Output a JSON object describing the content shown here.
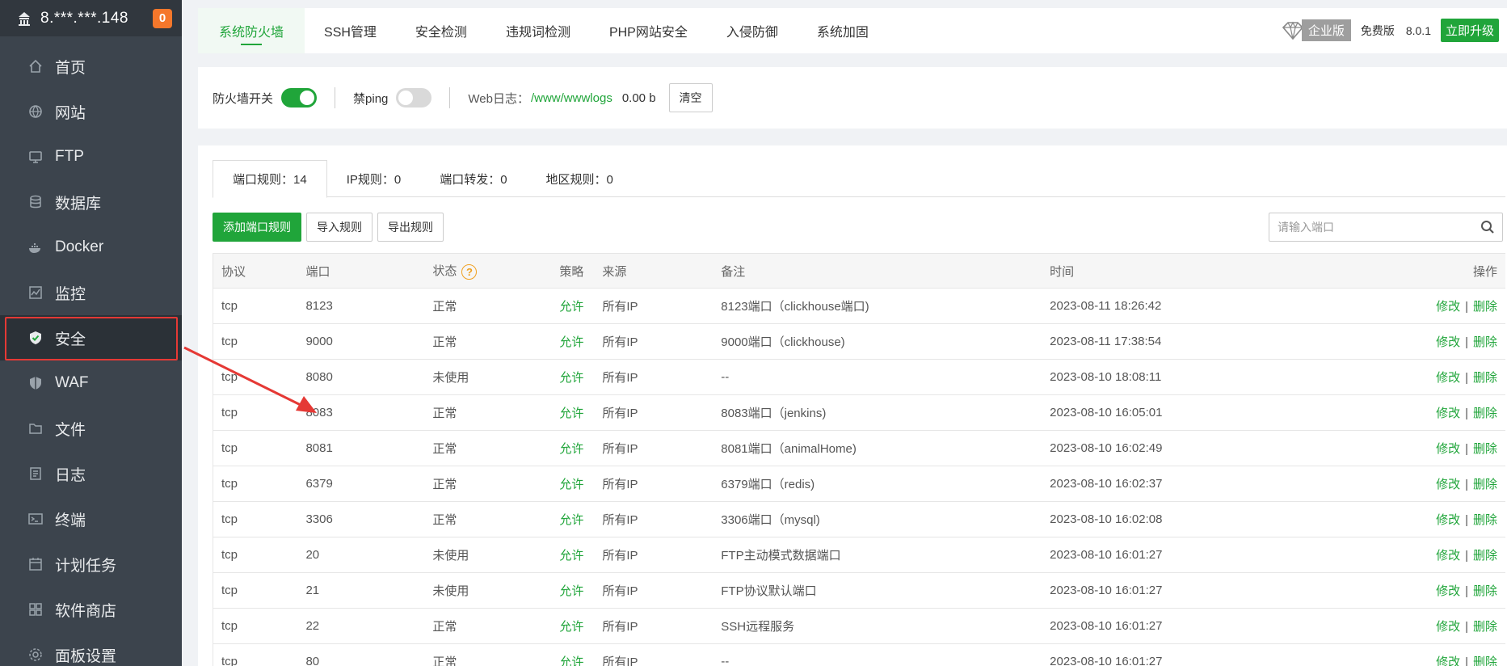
{
  "sidebar": {
    "host": "8.***.***.148",
    "badge": "0",
    "items": [
      {
        "label": "首页",
        "icon": "home-icon"
      },
      {
        "label": "网站",
        "icon": "globe-icon"
      },
      {
        "label": "FTP",
        "icon": "ftp-icon"
      },
      {
        "label": "数据库",
        "icon": "database-icon"
      },
      {
        "label": "Docker",
        "icon": "docker-icon"
      },
      {
        "label": "监控",
        "icon": "monitor-icon"
      },
      {
        "label": "安全",
        "icon": "shield-icon",
        "active": true
      },
      {
        "label": "WAF",
        "icon": "waf-shield-icon"
      },
      {
        "label": "文件",
        "icon": "folder-icon"
      },
      {
        "label": "日志",
        "icon": "log-icon"
      },
      {
        "label": "终端",
        "icon": "terminal-icon"
      },
      {
        "label": "计划任务",
        "icon": "calendar-icon"
      },
      {
        "label": "软件商店",
        "icon": "apps-icon"
      },
      {
        "label": "面板设置",
        "icon": "settings-icon"
      }
    ]
  },
  "topbar": {
    "tabs": [
      "系统防火墙",
      "SSH管理",
      "安全检测",
      "违规词检测",
      "PHP网站安全",
      "入侵防御",
      "系统加固"
    ],
    "enterprise_label": "企业版",
    "free_label": "免费版",
    "version": "8.0.1",
    "upgrade_label": "立即升级"
  },
  "switches": {
    "firewall_label": "防火墙开关",
    "ping_label": "禁ping",
    "weblog_label": "Web日志：",
    "weblog_path": "/www/wwwlogs",
    "weblog_size": "0.00 b",
    "clear_label": "清空"
  },
  "subtabs": [
    "端口规则：14",
    "IP规则：0",
    "端口转发：0",
    "地区规则：0"
  ],
  "toolbar": {
    "add_label": "添加端口规则",
    "import_label": "导入规则",
    "export_label": "导出规则",
    "search_placeholder": "请输入端口"
  },
  "table": {
    "headers": [
      "协议",
      "端口",
      "状态",
      "策略",
      "来源",
      "备注",
      "时间",
      "操作"
    ],
    "edit_label": "修改",
    "delete_label": "删除",
    "sep": "|",
    "rows": [
      {
        "proto": "tcp",
        "port": "8123",
        "status": "正常",
        "policy": "允许",
        "source": "所有IP",
        "note": "8123端口（clickhouse端口)",
        "time": "2023-08-11 18:26:42"
      },
      {
        "proto": "tcp",
        "port": "9000",
        "status": "正常",
        "policy": "允许",
        "source": "所有IP",
        "note": "9000端口（clickhouse)",
        "time": "2023-08-11 17:38:54"
      },
      {
        "proto": "tcp",
        "port": "8080",
        "status": "未使用",
        "policy": "允许",
        "source": "所有IP",
        "note": "--",
        "time": "2023-08-10 18:08:11"
      },
      {
        "proto": "tcp",
        "port": "8083",
        "status": "正常",
        "policy": "允许",
        "source": "所有IP",
        "note": "8083端口（jenkins)",
        "time": "2023-08-10 16:05:01"
      },
      {
        "proto": "tcp",
        "port": "8081",
        "status": "正常",
        "policy": "允许",
        "source": "所有IP",
        "note": "8081端口（animalHome)",
        "time": "2023-08-10 16:02:49"
      },
      {
        "proto": "tcp",
        "port": "6379",
        "status": "正常",
        "policy": "允许",
        "source": "所有IP",
        "note": "6379端口（redis)",
        "time": "2023-08-10 16:02:37"
      },
      {
        "proto": "tcp",
        "port": "3306",
        "status": "正常",
        "policy": "允许",
        "source": "所有IP",
        "note": "3306端口（mysql)",
        "time": "2023-08-10 16:02:08"
      },
      {
        "proto": "tcp",
        "port": "20",
        "status": "未使用",
        "policy": "允许",
        "source": "所有IP",
        "note": "FTP主动模式数据端口",
        "time": "2023-08-10 16:01:27"
      },
      {
        "proto": "tcp",
        "port": "21",
        "status": "未使用",
        "policy": "允许",
        "source": "所有IP",
        "note": "FTP协议默认端口",
        "time": "2023-08-10 16:01:27"
      },
      {
        "proto": "tcp",
        "port": "22",
        "status": "正常",
        "policy": "允许",
        "source": "所有IP",
        "note": "SSH远程服务",
        "time": "2023-08-10 16:01:27"
      },
      {
        "proto": "tcp",
        "port": "80",
        "status": "正常",
        "policy": "允许",
        "source": "所有IP",
        "note": "--",
        "time": "2023-08-10 16:01:27"
      }
    ]
  },
  "colors": {
    "accent": "#20a53a",
    "sidebar_bg": "#3c444d",
    "highlight": "#e53935",
    "badge": "#f5772b"
  }
}
